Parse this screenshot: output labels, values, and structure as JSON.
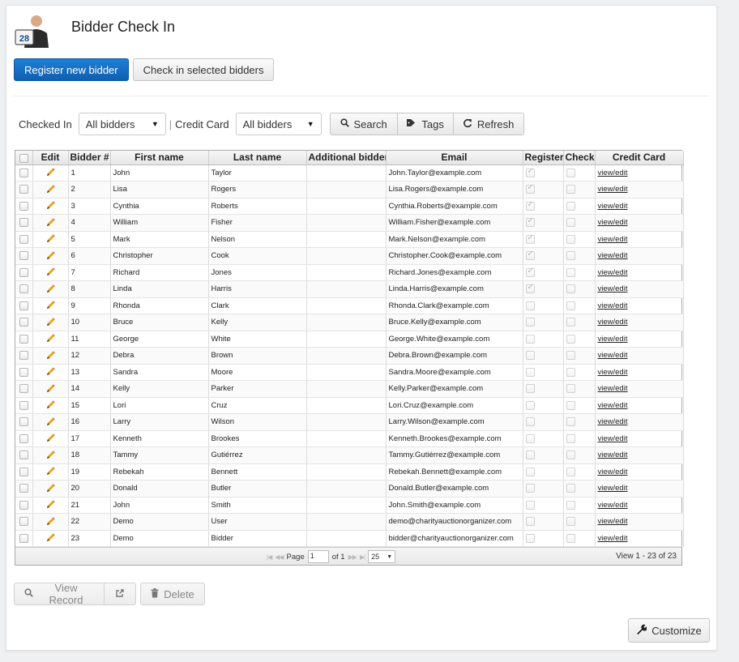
{
  "header": {
    "title": "Bidder Check In",
    "logo_number": "28"
  },
  "actions": {
    "register_label": "Register new bidder",
    "checkin_label": "Check in selected bidders"
  },
  "filters": {
    "checked_in_label": "Checked In",
    "checked_in_value": "All bidders",
    "separator": "|",
    "credit_card_label": "Credit Card",
    "credit_card_value": "All bidders",
    "search_label": "Search",
    "tags_label": "Tags",
    "refresh_label": "Refresh"
  },
  "table": {
    "columns": [
      "",
      "Edit",
      "Bidder #",
      "First name",
      "Last name",
      "Additional bidders",
      "Email",
      "Registered",
      "Checked In",
      "Credit Card"
    ],
    "link_text": "view/edit",
    "rows": [
      {
        "num": "1",
        "first": "John",
        "last": "Taylor",
        "email": "John.Taylor@example.com",
        "registered": true
      },
      {
        "num": "2",
        "first": "Lisa",
        "last": "Rogers",
        "email": "Lisa.Rogers@example.com",
        "registered": true
      },
      {
        "num": "3",
        "first": "Cynthia",
        "last": "Roberts",
        "email": "Cynthia.Roberts@example.com",
        "registered": true
      },
      {
        "num": "4",
        "first": "William",
        "last": "Fisher",
        "email": "William.Fisher@example.com",
        "registered": true
      },
      {
        "num": "5",
        "first": "Mark",
        "last": "Nelson",
        "email": "Mark.Nelson@example.com",
        "registered": true
      },
      {
        "num": "6",
        "first": "Christopher",
        "last": "Cook",
        "email": "Christopher.Cook@example.com",
        "registered": true
      },
      {
        "num": "7",
        "first": "Richard",
        "last": "Jones",
        "email": "Richard.Jones@example.com",
        "registered": true
      },
      {
        "num": "8",
        "first": "Linda",
        "last": "Harris",
        "email": "Linda.Harris@example.com",
        "registered": true
      },
      {
        "num": "9",
        "first": "Rhonda",
        "last": "Clark",
        "email": "Rhonda.Clark@example.com",
        "registered": false
      },
      {
        "num": "10",
        "first": "Bruce",
        "last": "Kelly",
        "email": "Bruce.Kelly@example.com",
        "registered": false
      },
      {
        "num": "11",
        "first": "George",
        "last": "White",
        "email": "George.White@example.com",
        "registered": false
      },
      {
        "num": "12",
        "first": "Debra",
        "last": "Brown",
        "email": "Debra.Brown@example.com",
        "registered": false
      },
      {
        "num": "13",
        "first": "Sandra",
        "last": "Moore",
        "email": "Sandra.Moore@example.com",
        "registered": false
      },
      {
        "num": "14",
        "first": "Kelly",
        "last": "Parker",
        "email": "Kelly.Parker@example.com",
        "registered": false
      },
      {
        "num": "15",
        "first": "Lori",
        "last": "Cruz",
        "email": "Lori.Cruz@example.com",
        "registered": false
      },
      {
        "num": "16",
        "first": "Larry",
        "last": "Wilson",
        "email": "Larry.Wilson@example.com",
        "registered": false
      },
      {
        "num": "17",
        "first": "Kenneth",
        "last": "Brookes",
        "email": "Kenneth.Brookes@example.com",
        "registered": false
      },
      {
        "num": "18",
        "first": "Tammy",
        "last": "Gutiérrez",
        "email": "Tammy.Gutiérrez@example.com",
        "registered": false
      },
      {
        "num": "19",
        "first": "Rebekah",
        "last": "Bennett",
        "email": "Rebekah.Bennett@example.com",
        "registered": false
      },
      {
        "num": "20",
        "first": "Donald",
        "last": "Butler",
        "email": "Donald.Butler@example.com",
        "registered": false
      },
      {
        "num": "21",
        "first": "John",
        "last": "Smith",
        "email": "John.Smith@example.com",
        "registered": false
      },
      {
        "num": "22",
        "first": "Demo",
        "last": "User",
        "email": "demo@charityauctionorganizer.com",
        "registered": false
      },
      {
        "num": "23",
        "first": "Demo",
        "last": "Bidder",
        "email": "bidder@charityauctionorganizer.com",
        "registered": false
      }
    ]
  },
  "pager": {
    "page_label": "Page",
    "page_value": "1",
    "of_label": "of 1",
    "rows_per_page": "25",
    "view_info": "View 1 - 23 of 23"
  },
  "bottom": {
    "view_record_label": "View Record",
    "delete_label": "Delete",
    "customize_label": "Customize"
  },
  "colors": {
    "primary": "#1a73c9",
    "accent_pencil": "#e8a317"
  }
}
